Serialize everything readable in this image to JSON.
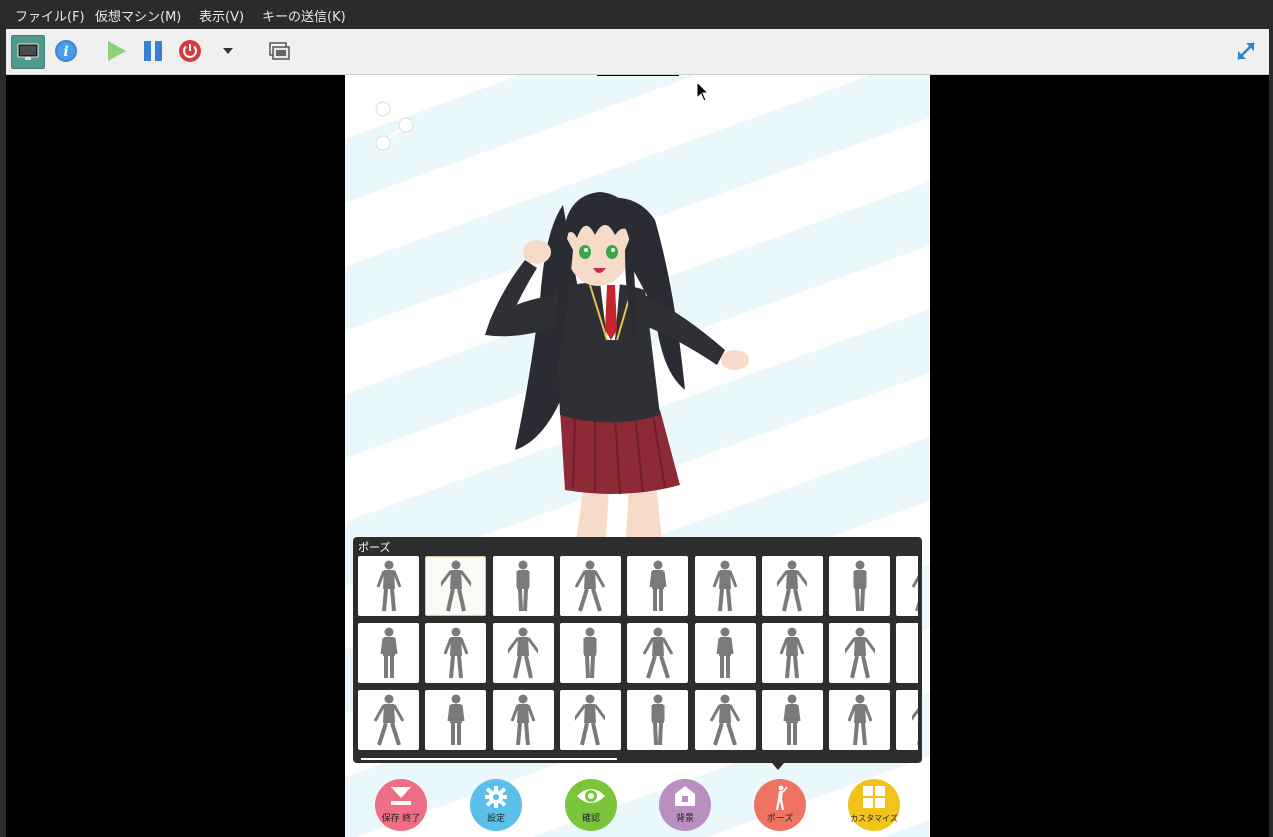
{
  "menu": {
    "items": [
      "ファイル(F)",
      "仮想マシン(M)",
      "表示(V)",
      "キーの送信(K)"
    ]
  },
  "toolbar": {
    "icons": [
      "monitor-icon",
      "info-icon",
      "play-icon",
      "pause-icon",
      "power-icon",
      "dropdown-icon",
      "screenshot-icon",
      "fullscreen-icon"
    ]
  },
  "pose_panel": {
    "title": "ポーズ"
  },
  "nav": {
    "save_label": "保存 終了",
    "settings_label": "設定",
    "confirm_label": "確認",
    "background_label": "背景",
    "pose_label": "ポーズ",
    "customize_label": "カスタマイズ"
  },
  "colors": {
    "save": "#f06d86",
    "settings": "#5bbfe9",
    "confirm": "#7cc53a",
    "background": "#b98fbf",
    "pose": "#ef7362",
    "customize": "#f2c31a"
  }
}
